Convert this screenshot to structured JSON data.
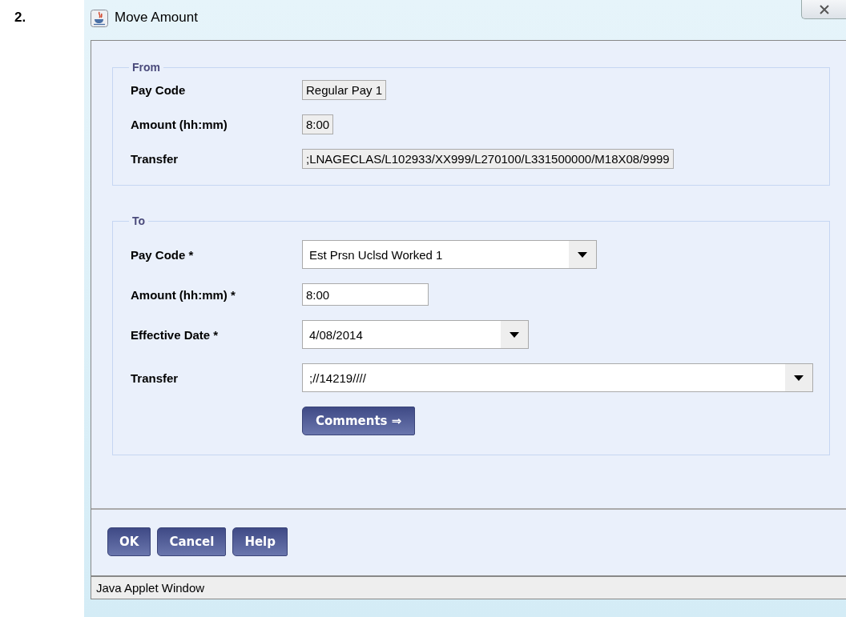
{
  "step": "2.",
  "window": {
    "title": "Move Amount"
  },
  "sections": [
    {
      "legend": "From",
      "fields": [
        {
          "kind": "readonly",
          "label": "Pay Code",
          "value": "Regular Pay 1"
        },
        {
          "kind": "readonly",
          "label": "Amount (hh:mm)",
          "value": "8:00"
        },
        {
          "kind": "readonly",
          "label": "Transfer",
          "value": ";LNAGECLAS/L102933/XX999/L270100/L331500000/M18X08/9999"
        }
      ]
    },
    {
      "legend": "To",
      "fields": [
        {
          "kind": "select",
          "label": "Pay Code *",
          "value": "Est Prsn Uclsd Worked 1"
        },
        {
          "kind": "text",
          "label": "Amount (hh:mm) *",
          "value": "8:00"
        },
        {
          "kind": "select",
          "label": "Effective Date *",
          "value": "4/08/2014"
        },
        {
          "kind": "select",
          "label": "Transfer",
          "value": ";//14219////"
        }
      ],
      "action": "Comments ⇒"
    }
  ],
  "buttons": [
    "OK",
    "Cancel",
    "Help"
  ],
  "status_bar": "Java Applet Window"
}
